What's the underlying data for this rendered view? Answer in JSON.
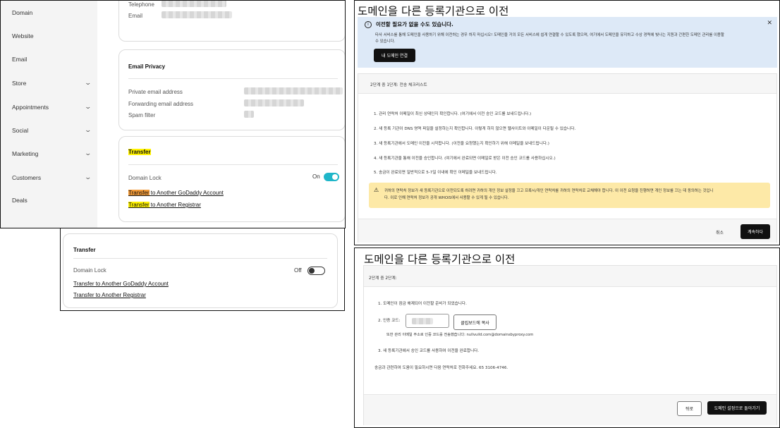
{
  "panel_a": {
    "sidebar": {
      "items": [
        {
          "label": "Domain",
          "chevron": false
        },
        {
          "label": "Website",
          "chevron": false
        },
        {
          "label": "Email",
          "chevron": false
        },
        {
          "label": "Store",
          "chevron": true
        },
        {
          "label": "Appointments",
          "chevron": true
        },
        {
          "label": "Social",
          "chevron": true
        },
        {
          "label": "Marketing",
          "chevron": true
        },
        {
          "label": "Customers",
          "chevron": true
        },
        {
          "label": "Deals",
          "chevron": false
        }
      ]
    },
    "contact": {
      "telephone_label": "Telephone",
      "email_label": "Email"
    },
    "email_privacy": {
      "title": "Email Privacy",
      "private_email_label": "Private email address",
      "forwarding_label": "Forwarding email address",
      "spam_filter_label": "Spam filter"
    },
    "transfer": {
      "title": "Transfer",
      "domain_lock_label": "Domain Lock",
      "lock_state": "On",
      "link1_prefix": "Transfer",
      "link1_rest": " to Another GoDaddy Account",
      "link2_prefix": "Transfer",
      "link2_rest": " to Another Registrar"
    }
  },
  "panel_b": {
    "title": "Transfer",
    "domain_lock_label": "Domain Lock",
    "lock_state": "Off",
    "link1": "Transfer to Another GoDaddy Account",
    "link2": "Transfer to Another Registrar"
  },
  "panel_c": {
    "title": "도메인을 다른 등록기관으로 이전",
    "info": {
      "heading": "이전할 필요가 없을 수도 있습니다.",
      "body_line1": "타사 서비스를 통해 도메인을 사용하기 위해 이전하는 경우 하지 마십시오! 도메인을 거의 모든 서비스에 쉽게 연결할 수 있도록 했으며, 여기에서 도메인을 유지하고 수상 경력에 빛나는 지원과 간편한 도메인 관리를 이용할",
      "body_line2": "수 있습니다.",
      "connect_button": "내 도메인 연결"
    },
    "step_header": "2단계 중 1단계: 전송 체크리스트",
    "steps": [
      "1. 관리 연락처 이메일이 최신 상태인지 확인합니다. (여기에서 이전 승인 코드를 보내드립니다.)",
      "2. 새 등록 기관이 DNS 영역 파일을 설정하는지 확인합니다. 이렇게 하지 않으면 웹사이트와 이메일이 다운될 수 있습니다.",
      "3. 새 등록기관에서 도메인 이전을 시작합니다. (이전을 요청했는지 확인하기 위해 이메일을 보내드립니다.)",
      "4. 새 등록기관을 통해 이전을 승인합니다. (여기에서 완료되면 이메일로 받은 이전 승인 코드를 사용하십시오.)",
      "5. 송금이 완료되면 일반적으로 5-7일 이내에 확인 이메일을 보내드립니다."
    ],
    "warning_line1": "귀하의 연락처 정보가 새 등록기관으로 이전되도록 하려면 귀하의 개인 정보 설정을 끄고 프록시/개인 연락처를 귀하의 연락처로 교체해야 합니다. 이 이전 요청을 진행하면 개인 정보를 끄는 데 동의하는 것입니",
    "warning_line2": "다. 이로 인해 연락처 정보가 공개 WHOIS에서 사용할 수 있게 될 수 있습니다.",
    "cancel_label": "취소",
    "continue_label": "계속하다"
  },
  "panel_d": {
    "title": "도메인을 다른 등록기관으로 이전",
    "step_header": "2단계 중 2단계:",
    "line1": "1. 도메인이 잠금 해제되어 이전할 준비가 되었습니다.",
    "auth_label": "2. 인증 코드:",
    "copy_button": "클립보드에 복사",
    "email_note": "또한 관리 이메일 주소로 인증 코드를 전송했습니다: nullvuild.com@domainsbyproxy.com",
    "line3": "3. 새 등록기관에서 승인 코드를 사용하여 이전을 완료합니다.",
    "contact_note": "송금과 관련하여 도움이 필요하시면 다음 연락처로 전화주세요. 65 3106-4746.",
    "back_button": "뒤로",
    "return_button": "도메인 설정으로 돌아가기"
  }
}
